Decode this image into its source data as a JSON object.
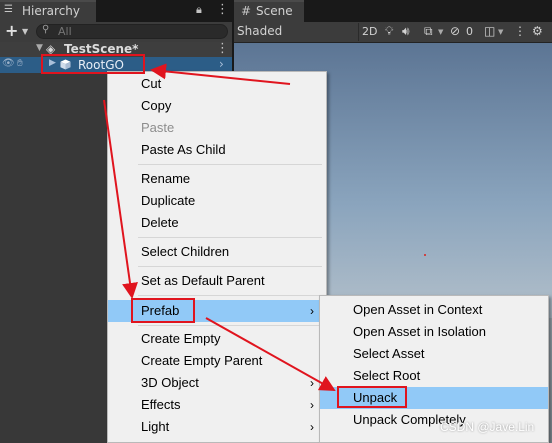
{
  "hierarchy": {
    "tab_title": "Hierarchy",
    "tab_icon": "list-icon",
    "add_label": "+",
    "search_placeholder": "All",
    "scene_name": "TestScene*",
    "gameobject_name": "RootGO"
  },
  "scene": {
    "tab_title": "Scene",
    "tab_icon": "grid-icon",
    "shading_mode": "Shaded",
    "mode_2d": "2D",
    "hidden_count": "0"
  },
  "context_menu": {
    "items": [
      {
        "label": "Cut"
      },
      {
        "label": "Copy"
      },
      {
        "label": "Paste",
        "disabled": true
      },
      {
        "label": "Paste As Child"
      },
      {
        "label": "Rename"
      },
      {
        "label": "Duplicate"
      },
      {
        "label": "Delete"
      },
      {
        "label": "Select Children"
      },
      {
        "label": "Set as Default Parent"
      },
      {
        "label": "Prefab",
        "highlighted": true,
        "submenu": true
      },
      {
        "label": "Create Empty"
      },
      {
        "label": "Create Empty Parent"
      },
      {
        "label": "3D Object",
        "submenu": true
      },
      {
        "label": "Effects",
        "submenu": true
      },
      {
        "label": "Light",
        "submenu": true
      }
    ]
  },
  "prefab_submenu": {
    "items": [
      {
        "label": "Open Asset in Context"
      },
      {
        "label": "Open Asset in Isolation"
      },
      {
        "label": "Select Asset"
      },
      {
        "label": "Select Root"
      },
      {
        "label": "Unpack",
        "highlighted": true
      },
      {
        "label": "Unpack Completely"
      }
    ]
  },
  "colors": {
    "selection": "#2c5d87",
    "menu_highlight": "#91c9f7",
    "annotation_red": "#e0141e"
  },
  "watermark": "CSDN @Jave.Lin"
}
